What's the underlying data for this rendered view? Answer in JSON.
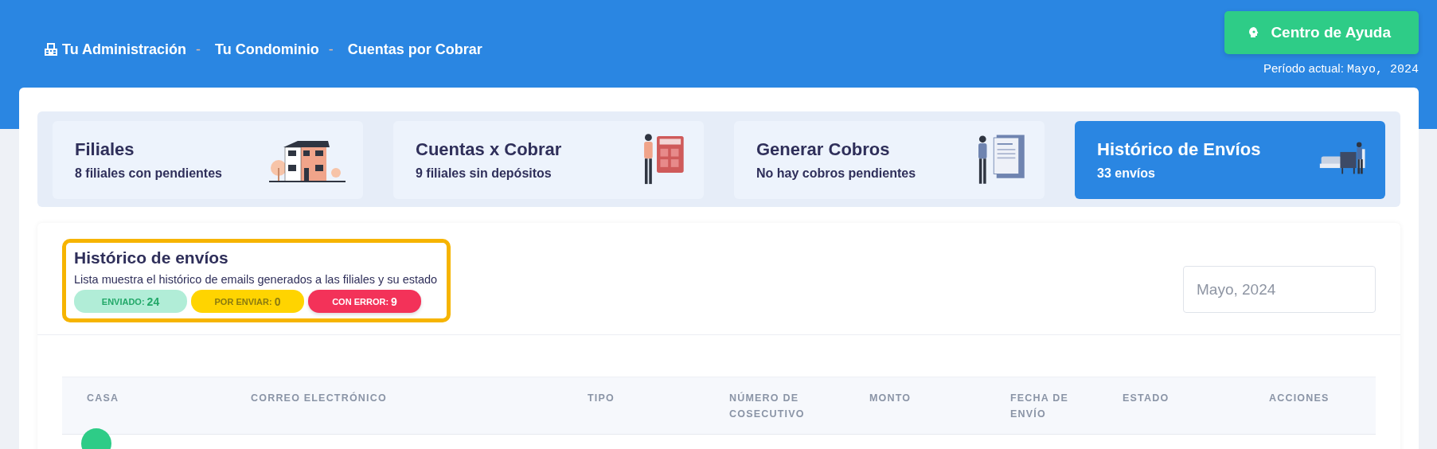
{
  "breadcrumb": [
    {
      "label": "Tu Administración"
    },
    {
      "separator": "-",
      "label": "Tu Condominio"
    },
    {
      "separator": "-",
      "label": "Cuentas por Cobrar"
    }
  ],
  "help_button": {
    "label": "Centro de Ayuda"
  },
  "period": {
    "label": "Período actual:",
    "value": "Mayo, 2024"
  },
  "cards": [
    {
      "title": "Filiales",
      "subtitle": "8 filiales con pendientes",
      "kind": "house",
      "selected": false
    },
    {
      "title": "Cuentas x Cobrar",
      "subtitle": "9 filiales sin depósitos",
      "kind": "calculator",
      "selected": false
    },
    {
      "title": "Generar Cobros",
      "subtitle": "No hay cobros pendientes",
      "kind": "invoice",
      "selected": false
    },
    {
      "title": "Histórico de Envíos",
      "subtitle": "33 envíos",
      "kind": "printer",
      "selected": true
    }
  ],
  "section": {
    "title": "Histórico de envíos",
    "description": "Lista muestra el histórico de emails generados a las filiales y su estado",
    "highlighted": true,
    "badges": [
      {
        "label": "ENVIADO:",
        "count": "24",
        "kind": "sent"
      },
      {
        "label": "POR ENVIAR:",
        "count": "0",
        "kind": "pending"
      },
      {
        "label": "CON ERROR:",
        "count": "9",
        "kind": "error"
      }
    ],
    "date_field": {
      "value": "Mayo, 2024"
    }
  },
  "table": {
    "columns": [
      {
        "label": "CASA"
      },
      {
        "label": "CORREO ELECTRÓNICO"
      },
      {
        "label": "TIPO"
      },
      {
        "label": "NÚMERO DE COSECUTIVO"
      },
      {
        "label": "MONTO"
      },
      {
        "label": "FECHA DE ENVÍO"
      },
      {
        "label": "ESTADO"
      },
      {
        "label": "ACCIONES"
      }
    ]
  }
}
